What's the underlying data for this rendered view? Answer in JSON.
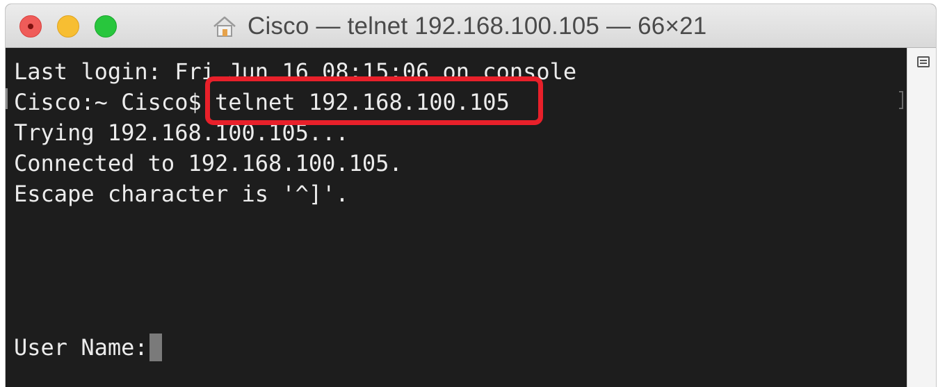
{
  "window": {
    "title": "Cisco — telnet 192.168.100.105 — 66×21",
    "icons": {
      "close": "close-button",
      "minimize": "minimize-button",
      "maximize": "zoom-button",
      "title_icon": "home-icon",
      "scroll_menu": "scrollbar-menu-icon"
    }
  },
  "terminal": {
    "lines": [
      "Last login: Fri Jun 16 08:15:06 on console",
      "Cisco:~ Cisco$ ",
      "Trying 192.168.100.105...",
      "Connected to 192.168.100.105.",
      "Escape character is '^]'."
    ],
    "command": "telnet 192.168.100.105",
    "prompt_label": "User Name:"
  },
  "colors": {
    "terminal_background": "#1d1d1d",
    "terminal_text": "#ececec",
    "highlight": "#e8202a"
  }
}
